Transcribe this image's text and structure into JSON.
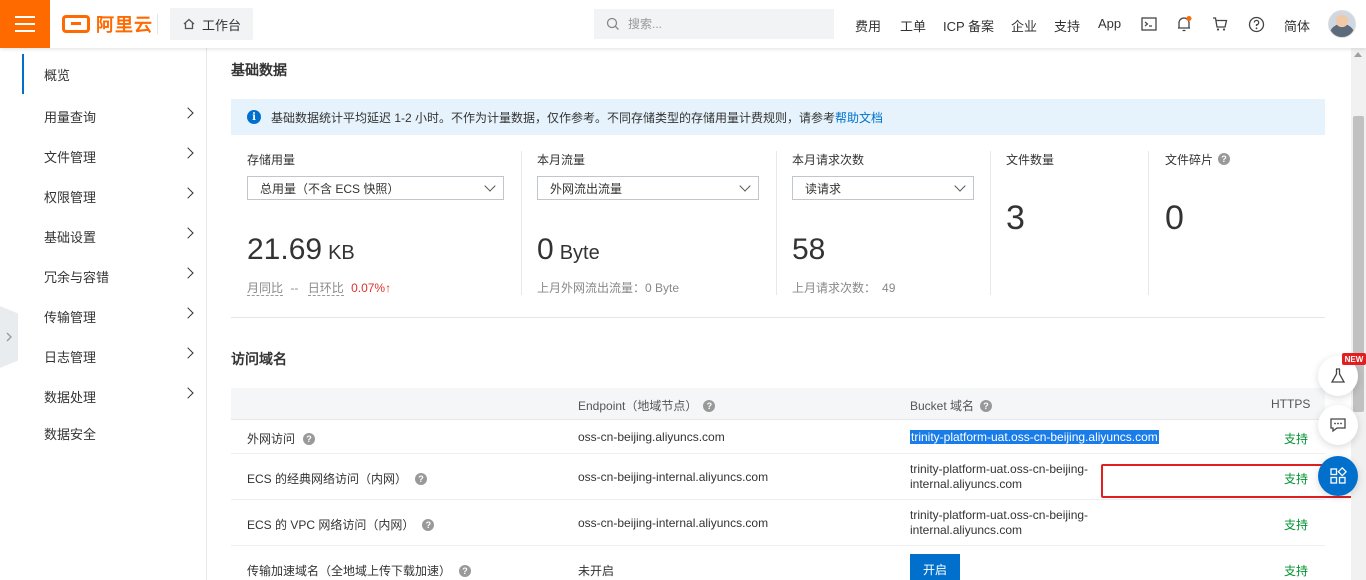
{
  "topbar": {
    "logo_text": "阿里云",
    "workbench_label": "工作台",
    "search_placeholder": "搜索...",
    "nav": [
      "费用",
      "工单",
      "ICP 备案",
      "企业",
      "支持",
      "App"
    ],
    "lang": "简体",
    "brand_color": "#ff6a00"
  },
  "sidebar": {
    "items": [
      {
        "label": "概览",
        "active": true,
        "expandable": false
      },
      {
        "label": "用量查询",
        "expandable": true
      },
      {
        "label": "文件管理",
        "expandable": true
      },
      {
        "label": "权限管理",
        "expandable": true
      },
      {
        "label": "基础设置",
        "expandable": true
      },
      {
        "label": "冗余与容错",
        "expandable": true
      },
      {
        "label": "传输管理",
        "expandable": true
      },
      {
        "label": "日志管理",
        "expandable": true
      },
      {
        "label": "数据处理",
        "expandable": true
      },
      {
        "label": "数据安全",
        "expandable": false
      }
    ]
  },
  "basic": {
    "title": "基础数据",
    "notice_text": "基础数据统计平均延迟 1-2 小时。不作为计量数据，仅作参考。不同存储类型的存储用量计费规则，请参考",
    "notice_link": "帮助文档",
    "storage": {
      "label": "存储用量",
      "select_value": "总用量（不含 ECS 快照）",
      "value": "21.69",
      "unit": "KB",
      "mom_label": "月同比",
      "mom_value": "--",
      "dod_label": "日环比",
      "dod_value": "0.07%↑"
    },
    "traffic": {
      "label": "本月流量",
      "select_value": "外网流出流量",
      "value": "0",
      "unit": "Byte",
      "sub": "上月外网流出流量：0 Byte"
    },
    "requests": {
      "label": "本月请求次数",
      "select_value": "读请求",
      "value": "58",
      "sub_label": "上月请求次数：",
      "sub_value": "49"
    },
    "files": {
      "label": "文件数量",
      "value": "3"
    },
    "fragments": {
      "label": "文件碎片",
      "value": "0"
    }
  },
  "domains": {
    "title": "访问域名",
    "headers": {
      "endpoint": "Endpoint（地域节点）",
      "bucket": "Bucket 域名",
      "https": "HTTPS"
    },
    "rows": [
      {
        "type": "外网访问",
        "endpoint": "oss-cn-beijing.aliyuncs.com",
        "bucket": "trinity-platform-uat.oss-cn-beijing.aliyuncs.com",
        "https": "支持"
      },
      {
        "type": "ECS 的经典网络访问（内网）",
        "endpoint": "oss-cn-beijing-internal.aliyuncs.com",
        "bucket": "trinity-platform-uat.oss-cn-beijing-internal.aliyuncs.com",
        "https": "支持"
      },
      {
        "type": "ECS 的 VPC 网络访问（内网）",
        "endpoint": "oss-cn-beijing-internal.aliyuncs.com",
        "bucket": "trinity-platform-uat.oss-cn-beijing-internal.aliyuncs.com",
        "https": "支持"
      },
      {
        "type": "传输加速域名（全地域上传下载加速）",
        "endpoint": "未开启",
        "bucket_button": "开启",
        "https": "支持"
      }
    ]
  },
  "widgets": {
    "new_badge": "NEW"
  }
}
